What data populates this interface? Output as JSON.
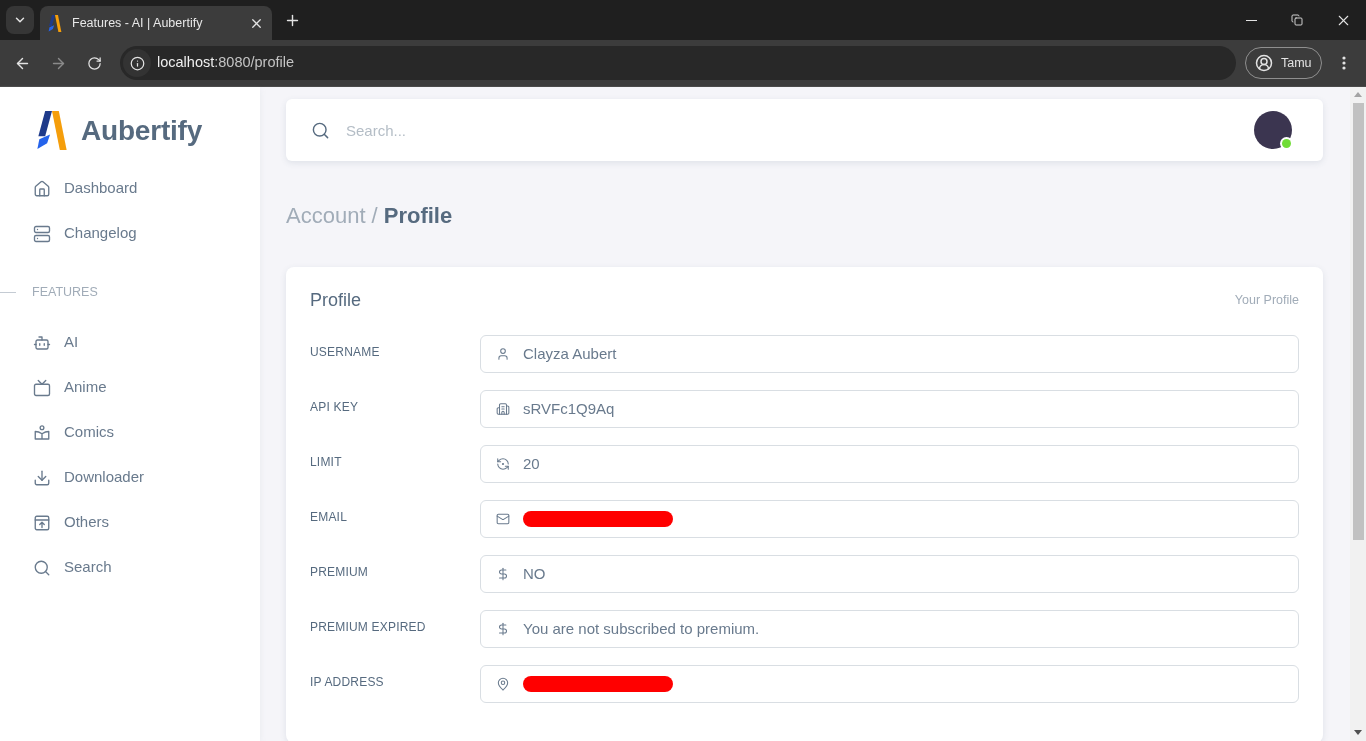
{
  "browser": {
    "tabs": [
      {
        "title": "Features - AI | Aubertify",
        "selected": true
      }
    ],
    "url": {
      "host": "localhost",
      "path": ":8080/profile"
    },
    "profile_name": "Tamu"
  },
  "sidebar": {
    "brand": "Aubertify",
    "sections": [
      {
        "items": [
          {
            "label": "Dashboard",
            "selected": false
          },
          {
            "label": "Changelog",
            "selected": false
          }
        ]
      },
      {
        "heading": "FEATURES",
        "items": [
          {
            "label": "AI",
            "selected": false
          },
          {
            "label": "Anime",
            "selected": false
          },
          {
            "label": "Comics",
            "selected": false
          },
          {
            "label": "Downloader",
            "selected": false
          },
          {
            "label": "Others",
            "selected": false
          },
          {
            "label": "Search",
            "selected": false
          }
        ]
      }
    ]
  },
  "header": {
    "search": {
      "placeholder": "Search..."
    },
    "avatar": {
      "online": true
    }
  },
  "breadcrumb": {
    "parent": "Account /",
    "current": "Profile"
  },
  "profile_card": {
    "title": "Profile",
    "subtitle": "Your Profile",
    "fields": [
      {
        "label": "USERNAME",
        "value": "Clayza Aubert",
        "redacted": false
      },
      {
        "label": "API KEY",
        "value": "sRVFc1Q9Aq",
        "redacted": false
      },
      {
        "label": "LIMIT",
        "value": "20",
        "redacted": false
      },
      {
        "label": "EMAIL",
        "redacted": true
      },
      {
        "label": "PREMIUM",
        "value": "NO",
        "redacted": false
      },
      {
        "label": "PREMIUM EXPIRED",
        "value": "You are not subscribed to premium.",
        "redacted": false
      },
      {
        "label": "IP ADDRESS",
        "redacted": true
      }
    ]
  }
}
